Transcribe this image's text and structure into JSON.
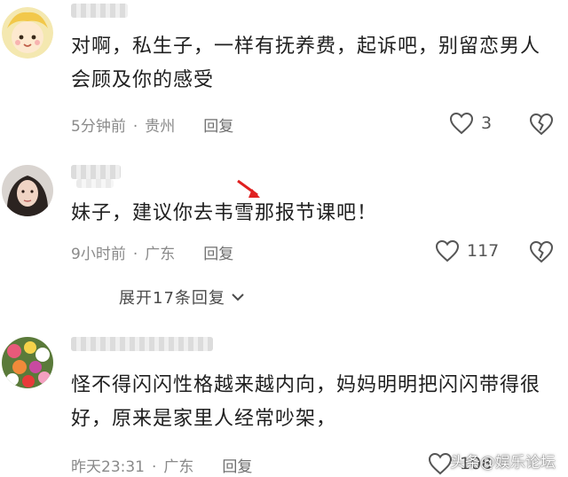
{
  "comments": [
    {
      "text": "对啊，私生子，一样有抚养费，起诉吧，别留恋男人会顾及你的感受",
      "time": "5分钟前",
      "location": "贵州",
      "reply": "回复",
      "likes": "3"
    },
    {
      "text": "妹子，建议你去韦雪那报节课吧！",
      "time": "9小时前",
      "location": "广东",
      "reply": "回复",
      "likes": "117",
      "expand": "展开17条回复"
    },
    {
      "text": "怪不得闪闪性格越来越内向，妈妈明明把闪闪带得很好，原来是家里人经常吵架，",
      "time": "昨天23:31",
      "location": "广东",
      "reply": "回复",
      "likes": "108"
    }
  ],
  "watermark": "头条@娱乐论坛",
  "icons": {
    "like": "heart-outline-icon",
    "dislike": "broken-heart-icon",
    "expand": "chevron-down-icon",
    "annotation": "red-arrow-icon"
  }
}
